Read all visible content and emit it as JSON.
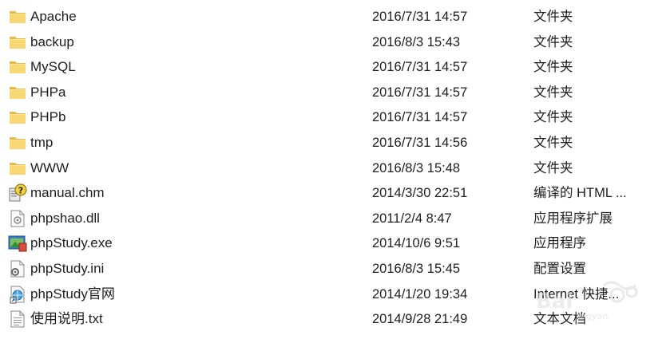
{
  "files": [
    {
      "name": "Apache",
      "date": "2016/7/31 14:57",
      "type": "文件夹",
      "icon": "folder-icon"
    },
    {
      "name": "backup",
      "date": "2016/8/3 15:43",
      "type": "文件夹",
      "icon": "folder-icon"
    },
    {
      "name": "MySQL",
      "date": "2016/7/31 14:57",
      "type": "文件夹",
      "icon": "folder-icon"
    },
    {
      "name": "PHPa",
      "date": "2016/7/31 14:57",
      "type": "文件夹",
      "icon": "folder-icon"
    },
    {
      "name": "PHPb",
      "date": "2016/7/31 14:57",
      "type": "文件夹",
      "icon": "folder-icon"
    },
    {
      "name": "tmp",
      "date": "2016/7/31 14:56",
      "type": "文件夹",
      "icon": "folder-icon"
    },
    {
      "name": "WWW",
      "date": "2016/8/3 15:48",
      "type": "文件夹",
      "icon": "folder-icon"
    },
    {
      "name": "manual.chm",
      "date": "2014/3/30 22:51",
      "type": "编译的 HTML ...",
      "icon": "chm-help-icon"
    },
    {
      "name": "phpshao.dll",
      "date": "2011/2/4 8:47",
      "type": "应用程序扩展",
      "icon": "dll-file-icon"
    },
    {
      "name": "phpStudy.exe",
      "date": "2014/10/6 9:51",
      "type": "应用程序",
      "icon": "exe-app-icon"
    },
    {
      "name": "phpStudy.ini",
      "date": "2016/8/3 15:45",
      "type": "配置设置",
      "icon": "ini-settings-icon"
    },
    {
      "name": "phpStudy官网",
      "date": "2014/1/20 19:34",
      "type": "Internet 快捷...",
      "icon": "internet-shortcut-icon"
    },
    {
      "name": "使用说明.txt",
      "date": "2014/9/28 21:49",
      "type": "文本文档",
      "icon": "text-file-icon"
    }
  ],
  "colors": {
    "folder": "#f8d775",
    "folder_dark": "#e8b84a",
    "text": "#1e1e1e"
  }
}
